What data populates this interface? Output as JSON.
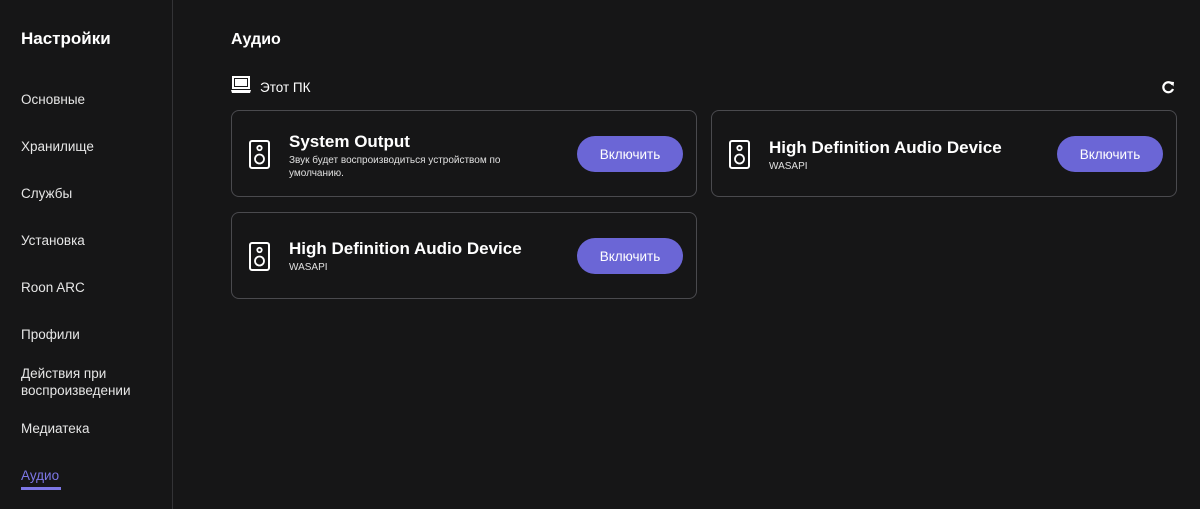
{
  "sidebar": {
    "title": "Настройки",
    "items": [
      {
        "label": "Основные"
      },
      {
        "label": "Хранилище"
      },
      {
        "label": "Службы"
      },
      {
        "label": "Установка"
      },
      {
        "label": "Roon ARC"
      },
      {
        "label": "Профили"
      },
      {
        "label": "Действия при воспроизведении"
      },
      {
        "label": "Медиатека"
      },
      {
        "label": "Аудио",
        "active": true
      }
    ]
  },
  "main": {
    "title": "Аудио",
    "section": {
      "label": "Этот ПК",
      "icon": "laptop-icon",
      "refresh_icon": "refresh-icon"
    },
    "devices": [
      {
        "name": "System Output",
        "subtitle": "Звук будет воспроизводиться устройством по умолчанию.",
        "button": "Включить",
        "icon": "speaker-icon"
      },
      {
        "name": "High Definition Audio Device",
        "subtitle": "WASAPI",
        "button": "Включить",
        "icon": "speaker-icon"
      },
      {
        "name": "High Definition Audio Device",
        "subtitle": "WASAPI",
        "button": "Включить",
        "icon": "speaker-icon"
      }
    ]
  },
  "colors": {
    "background": "#161617",
    "accent": "#7d77e6",
    "button": "#6b66d6",
    "card_border": "#4a4a4e"
  }
}
